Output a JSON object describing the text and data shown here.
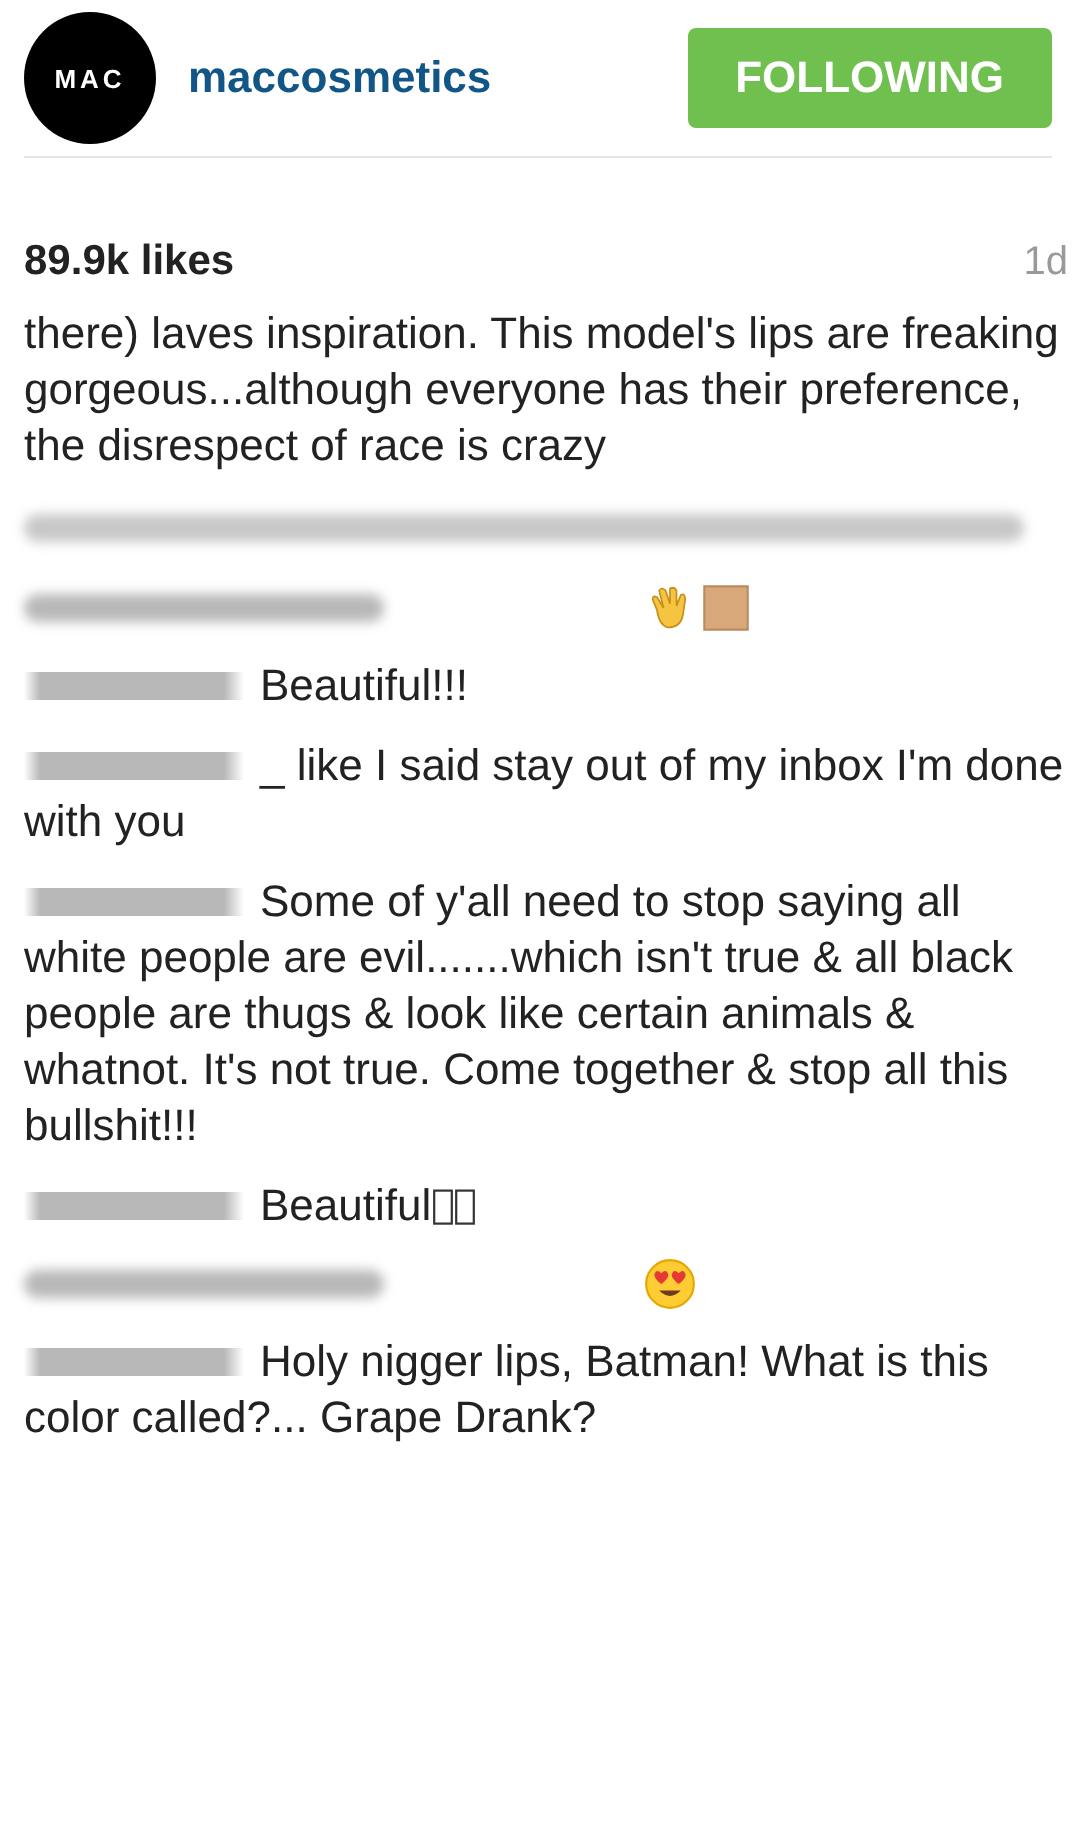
{
  "header": {
    "logo": "MAC",
    "username": "maccosmetics",
    "follow_button": "FOLLOWING"
  },
  "likes": "89.9k likes",
  "time": "1d",
  "comments": [
    {
      "kind": "comment",
      "username_hidden": false,
      "text": "there) laves inspiration. This model's lips are freaking gorgeous...although everyone has their preference, the disrespect of race is crazy"
    },
    {
      "kind": "hidden"
    },
    {
      "kind": "comment",
      "username_hidden": true,
      "icons": [
        {
          "kind": "wave"
        },
        {
          "kind": "skin-tone"
        }
      ]
    },
    {
      "kind": "comment",
      "username_hidden": true,
      "text": "Beautiful!!!"
    },
    {
      "kind": "comment",
      "username_hidden": true,
      "text": "_ like I said stay out of my inbox I'm done with you"
    },
    {
      "kind": "comment",
      "username_hidden": true,
      "text": "Some of y'all need to stop saying all white people are evil.......which isn't true & all black people are thugs & look like certain animals & whatnot. It's not true. Come together & stop all this bullshit!!!"
    },
    {
      "kind": "comment",
      "username_hidden": true,
      "text": "Beautiful",
      "icons": [
        {
          "kind": "missing-glyph"
        },
        {
          "kind": "missing-glyph"
        }
      ]
    },
    {
      "kind": "comment",
      "username_hidden": true,
      "icons": [
        {
          "kind": "heart-eyes"
        }
      ]
    },
    {
      "kind": "comment",
      "username_hidden": true,
      "text": "Holy nigger lips, Batman! What is this color called?... Grape Drank?"
    }
  ]
}
